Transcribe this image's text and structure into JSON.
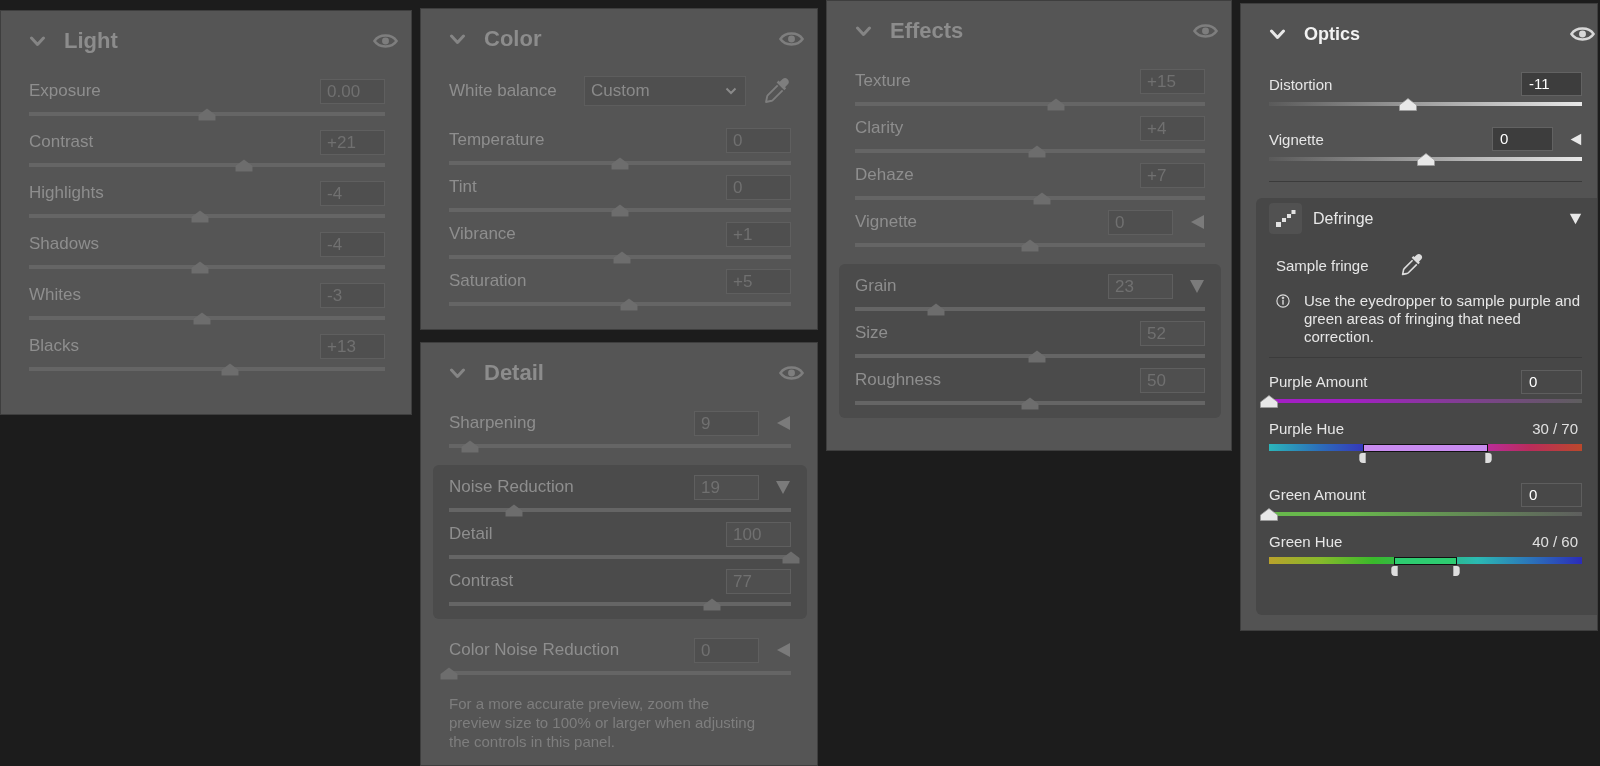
{
  "columns": [
    {
      "panels": [
        {
          "title": "Light",
          "expanded": true,
          "disabled": true,
          "rows": [
            {
              "kind": "slider",
              "label": "Exposure",
              "value": "0.00",
              "level": 0.5
            },
            {
              "kind": "slider",
              "label": "Contrast",
              "value": "+21",
              "level": 0.605
            },
            {
              "kind": "slider",
              "label": "Highlights",
              "value": "-4",
              "level": 0.48
            },
            {
              "kind": "slider",
              "label": "Shadows",
              "value": "-4",
              "level": 0.48
            },
            {
              "kind": "slider",
              "label": "Whites",
              "value": "-3",
              "level": 0.485
            },
            {
              "kind": "slider",
              "label": "Blacks",
              "value": "+13",
              "level": 0.565
            }
          ]
        }
      ]
    },
    {
      "panels": [
        {
          "title": "Color",
          "expanded": true,
          "disabled": true,
          "rows": [
            {
              "kind": "select",
              "label": "White balance",
              "value": "Custom"
            },
            {
              "kind": "slider",
              "label": "Temperature",
              "value": "0",
              "level": 0.5
            },
            {
              "kind": "slider",
              "label": "Tint",
              "value": "0",
              "level": 0.5
            },
            {
              "kind": "slider",
              "label": "Vibrance",
              "value": "+1",
              "level": 0.505
            },
            {
              "kind": "slider",
              "label": "Saturation",
              "value": "+5",
              "level": 0.525
            }
          ]
        },
        {
          "title": "Detail",
          "expanded": true,
          "disabled": true,
          "rows": [
            {
              "kind": "slider",
              "label": "Sharpening",
              "value": "9",
              "level": 0.06,
              "expanded": false
            },
            {
              "kind": "slider",
              "label": "Noise Reduction",
              "value": "19",
              "level": 0.19,
              "expanded": true,
              "children": [
                {
                  "kind": "slider",
                  "label": "Detail",
                  "value": "100",
                  "level": 1
                },
                {
                  "kind": "slider",
                  "label": "Contrast",
                  "value": "77",
                  "level": 0.77
                }
              ]
            },
            {
              "kind": "slider",
              "label": "Color Noise Reduction",
              "value": "0",
              "level": 0,
              "expanded": false
            },
            {
              "kind": "note",
              "text": "For a more accurate preview, zoom the preview size to 100% or larger when adjusting the controls in this panel."
            }
          ]
        }
      ]
    },
    {
      "panels": [
        {
          "title": "Effects",
          "expanded": true,
          "disabled": true,
          "rows": [
            {
              "kind": "slider",
              "label": "Texture",
              "value": "+15",
              "level": 0.575
            },
            {
              "kind": "slider",
              "label": "Clarity",
              "value": "+4",
              "level": 0.52
            },
            {
              "kind": "slider",
              "label": "Dehaze",
              "value": "+7",
              "level": 0.535
            },
            {
              "kind": "slider",
              "label": "Vignette",
              "value": "0",
              "level": 0.5,
              "expanded": false
            },
            {
              "kind": "slider",
              "label": "Grain",
              "value": "23",
              "level": 0.23,
              "expanded": true,
              "children": [
                {
                  "kind": "slider",
                  "label": "Size",
                  "value": "52",
                  "level": 0.52
                },
                {
                  "kind": "slider",
                  "label": "Roughness",
                  "value": "50",
                  "level": 0.5
                }
              ]
            }
          ]
        }
      ]
    },
    {
      "panels": [
        {
          "title": "Optics",
          "expanded": true,
          "disabled": false,
          "rows": [
            {
              "kind": "slider",
              "label": "Distortion",
              "value": "-11",
              "level": 0.445
            },
            {
              "kind": "slider",
              "label": "Vignette",
              "value": "0",
              "level": 0.5,
              "expanded": false
            },
            {
              "kind": "section",
              "label": "Defringe",
              "expanded": true,
              "children": [
                {
                  "kind": "sampler",
                  "label": "Sample fringe"
                },
                {
                  "kind": "info",
                  "text": "Use the eyedropper to sample purple and green areas of fringing that need correction."
                },
                {
                  "kind": "amount",
                  "label": "Purple Amount",
                  "value": "0",
                  "level": 0,
                  "color": "#a31fc4"
                },
                {
                  "kind": "hue",
                  "label": "Purple Hue",
                  "value": "30 / 70",
                  "color": "#c98cf0",
                  "handles": [
                    {
                      "level": 0.3
                    },
                    {
                      "level": 0.7
                    }
                  ]
                },
                {
                  "kind": "amount",
                  "label": "Green Amount",
                  "value": "0",
                  "level": 0,
                  "color": "#68b84c"
                },
                {
                  "kind": "hue",
                  "label": "Green Hue",
                  "value": "40 / 60",
                  "color": "#2ecc71",
                  "handles": [
                    {
                      "level": 0.4
                    },
                    {
                      "level": 0.6
                    }
                  ]
                }
              ]
            }
          ]
        }
      ]
    }
  ]
}
